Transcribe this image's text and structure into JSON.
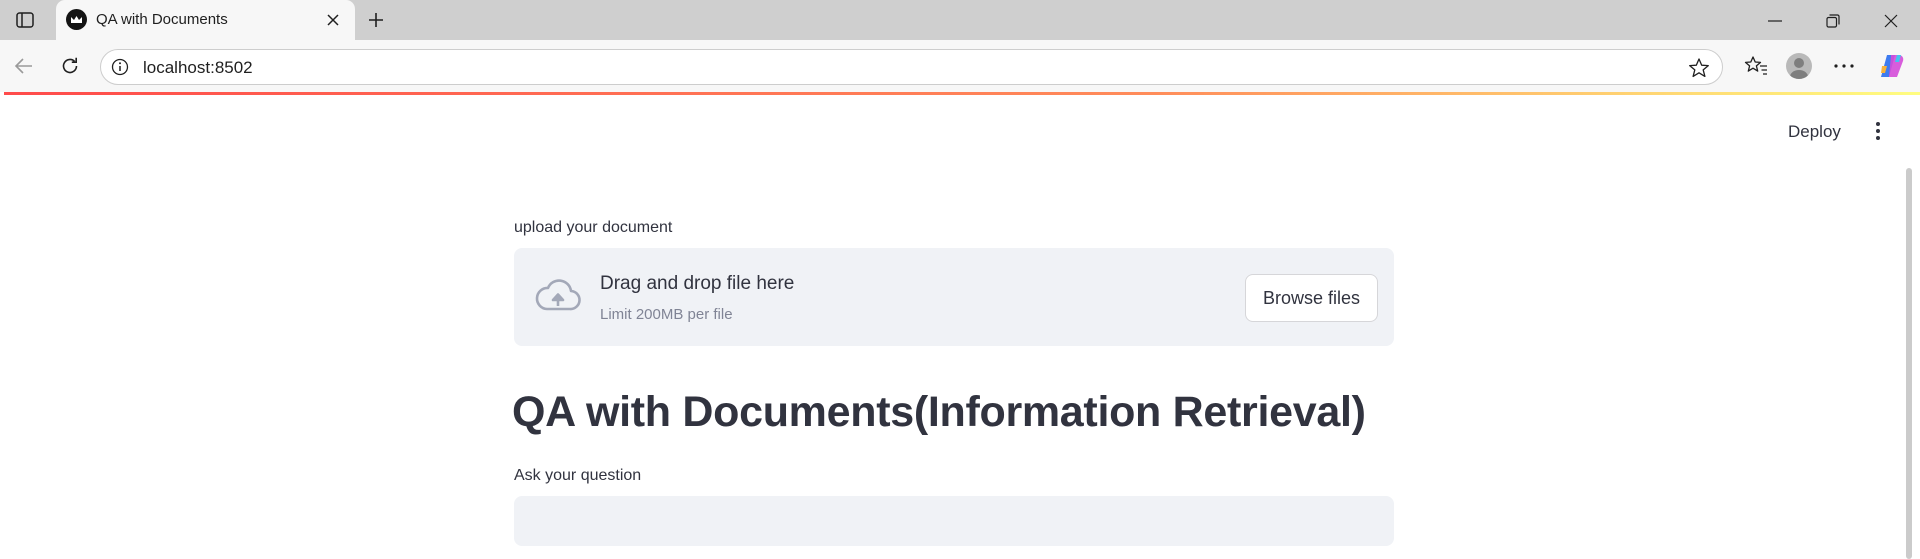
{
  "browser": {
    "tab_title": "QA with Documents",
    "url": "localhost:8502"
  },
  "icons": {
    "tab_sidebar": "tab-sidebar-icon",
    "favicon": "streamlit-crown-icon",
    "tab_close": "close-icon",
    "new_tab": "plus-icon",
    "minimize": "minimize-icon",
    "restore": "restore-icon",
    "close_window": "close-icon",
    "back": "arrow-left-icon",
    "reload": "reload-icon",
    "site_info": "info-icon",
    "favorite": "star-icon",
    "favorites": "favorites-icon",
    "profile": "avatar-icon",
    "more": "ellipsis-icon",
    "copilot": "copilot-icon",
    "app_menu": "kebab-icon",
    "upload": "cloud-upload-icon"
  },
  "app": {
    "deploy_label": "Deploy",
    "uploader": {
      "label": "upload your document",
      "drag_text": "Drag and drop file here",
      "limit_text": "Limit 200MB per file",
      "browse_label": "Browse files"
    },
    "title": "QA with Documents(Information Retrieval)",
    "question": {
      "label": "Ask your question",
      "value": ""
    }
  },
  "colors": {
    "streamlit_text": "#31333f",
    "input_background": "#f0f2f6",
    "accent_gradient_start": "#ff4b4b",
    "accent_gradient_end": "#fffd80"
  }
}
